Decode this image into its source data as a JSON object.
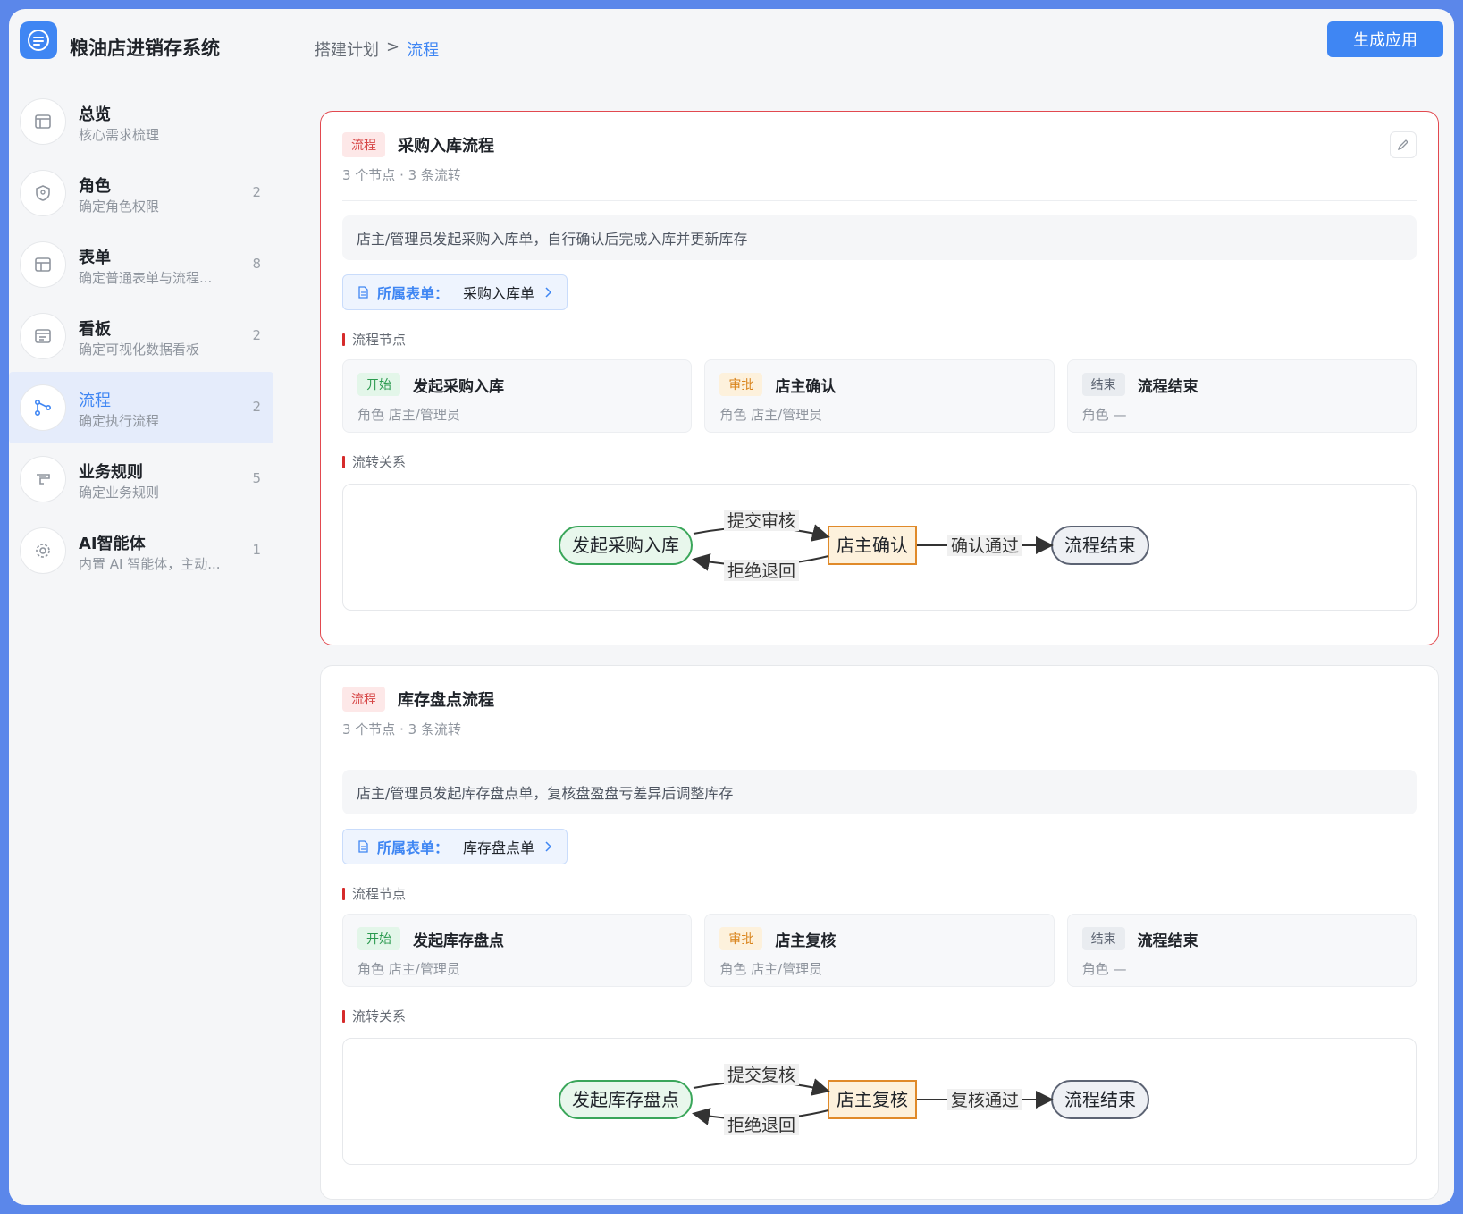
{
  "app": {
    "title": "粮油店进销存系统",
    "generate_label": "生成应用"
  },
  "breadcrumb": {
    "parent": "搭建计划",
    "separator": ">",
    "current": "流程"
  },
  "sidebar": {
    "items": [
      {
        "title": "总览",
        "sub": "核心需求梳理",
        "count": "",
        "icon": "overview-icon"
      },
      {
        "title": "角色",
        "sub": "确定角色权限",
        "count": "2",
        "icon": "shield-icon"
      },
      {
        "title": "表单",
        "sub": "确定普通表单与流程...",
        "count": "8",
        "icon": "table-icon"
      },
      {
        "title": "看板",
        "sub": "确定可视化数据看板",
        "count": "2",
        "icon": "dashboard-icon"
      },
      {
        "title": "流程",
        "sub": "确定执行流程",
        "count": "2",
        "icon": "flow-icon"
      },
      {
        "title": "业务规则",
        "sub": "确定业务规则",
        "count": "5",
        "icon": "rule-icon"
      },
      {
        "title": "AI智能体",
        "sub": "内置 AI 智能体，主动...",
        "count": "1",
        "icon": "gear-icon"
      }
    ]
  },
  "labels": {
    "form_link": "所属表单：",
    "nodes_section": "流程节点",
    "flows_section": "流转关系",
    "role_prefix": "角色"
  },
  "flows": [
    {
      "tag": "流程",
      "title": "采购入库流程",
      "meta": "3 个节点 · 3 条流转",
      "description": "店主/管理员发起采购入库单，自行确认后完成入库并更新库存",
      "form": "采购入库单",
      "nodes": [
        {
          "tag": "开始",
          "name": "发起采购入库",
          "role": "店主/管理员"
        },
        {
          "tag": "审批",
          "name": "店主确认",
          "role": "店主/管理员"
        },
        {
          "tag": "结束",
          "name": "流程结束",
          "role": "—"
        }
      ],
      "diagram": {
        "start": "发起采购入库",
        "approve": "店主确认",
        "end": "流程结束",
        "submit": "提交审核",
        "reject": "拒绝退回",
        "pass": "确认通过"
      }
    },
    {
      "tag": "流程",
      "title": "库存盘点流程",
      "meta": "3 个节点 · 3 条流转",
      "description": "店主/管理员发起库存盘点单，复核盘盈盘亏差异后调整库存",
      "form": "库存盘点单",
      "nodes": [
        {
          "tag": "开始",
          "name": "发起库存盘点",
          "role": "店主/管理员"
        },
        {
          "tag": "审批",
          "name": "店主复核",
          "role": "店主/管理员"
        },
        {
          "tag": "结束",
          "name": "流程结束",
          "role": "—"
        }
      ],
      "diagram": {
        "start": "发起库存盘点",
        "approve": "店主复核",
        "end": "流程结束",
        "submit": "提交复核",
        "reject": "拒绝退回",
        "pass": "复核通过"
      }
    }
  ]
}
